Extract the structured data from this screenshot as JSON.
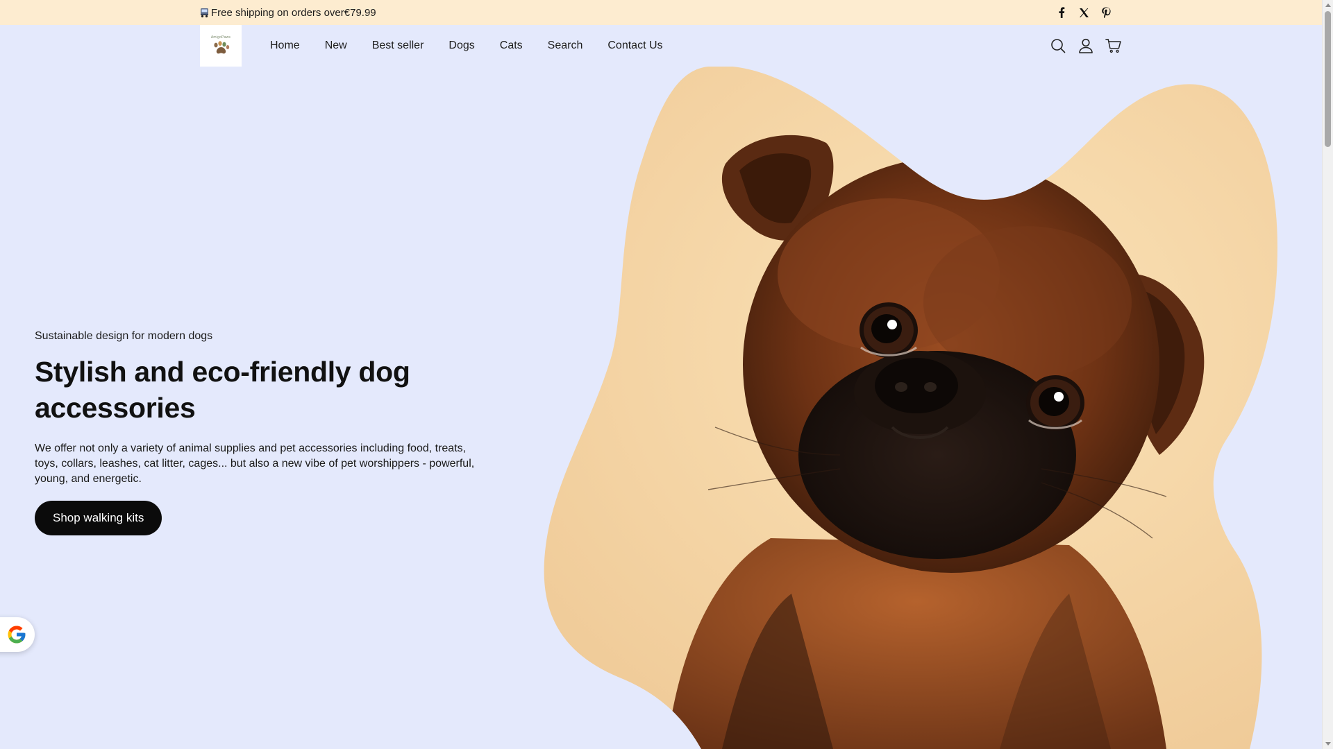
{
  "announcement": {
    "text": "Free shipping on orders over€79.99",
    "icon": "truck-icon"
  },
  "socials": [
    {
      "name": "facebook-icon"
    },
    {
      "name": "x-icon"
    },
    {
      "name": "pinterest-icon"
    }
  ],
  "logo": {
    "text": "AmigoPaws",
    "icon": "paw-logo"
  },
  "nav": {
    "items": [
      {
        "label": "Home"
      },
      {
        "label": "New"
      },
      {
        "label": "Best seller"
      },
      {
        "label": "Dogs"
      },
      {
        "label": "Cats"
      },
      {
        "label": "Search"
      },
      {
        "label": "Contact Us"
      }
    ]
  },
  "header_icons": [
    "search-icon",
    "account-icon",
    "cart-icon"
  ],
  "hero": {
    "eyebrow": "Sustainable design for modern dogs",
    "title": "Stylish and eco-friendly dog accessories",
    "description": "We offer not only a variety of animal supplies and pet accessories including food, treats, toys, collars, leashes, cat litter, cages... but also a new vibe of pet worshippers - powerful, young, and energetic.",
    "cta_label": "Shop walking kits"
  },
  "colors": {
    "background": "#e4e9fc",
    "announcement_bg": "#fdecd0",
    "cta_bg": "#0b0b0b",
    "cta_text": "#ffffff",
    "blob_bg": "#f6d9a8"
  },
  "floating_badge": {
    "icon": "google-icon"
  }
}
